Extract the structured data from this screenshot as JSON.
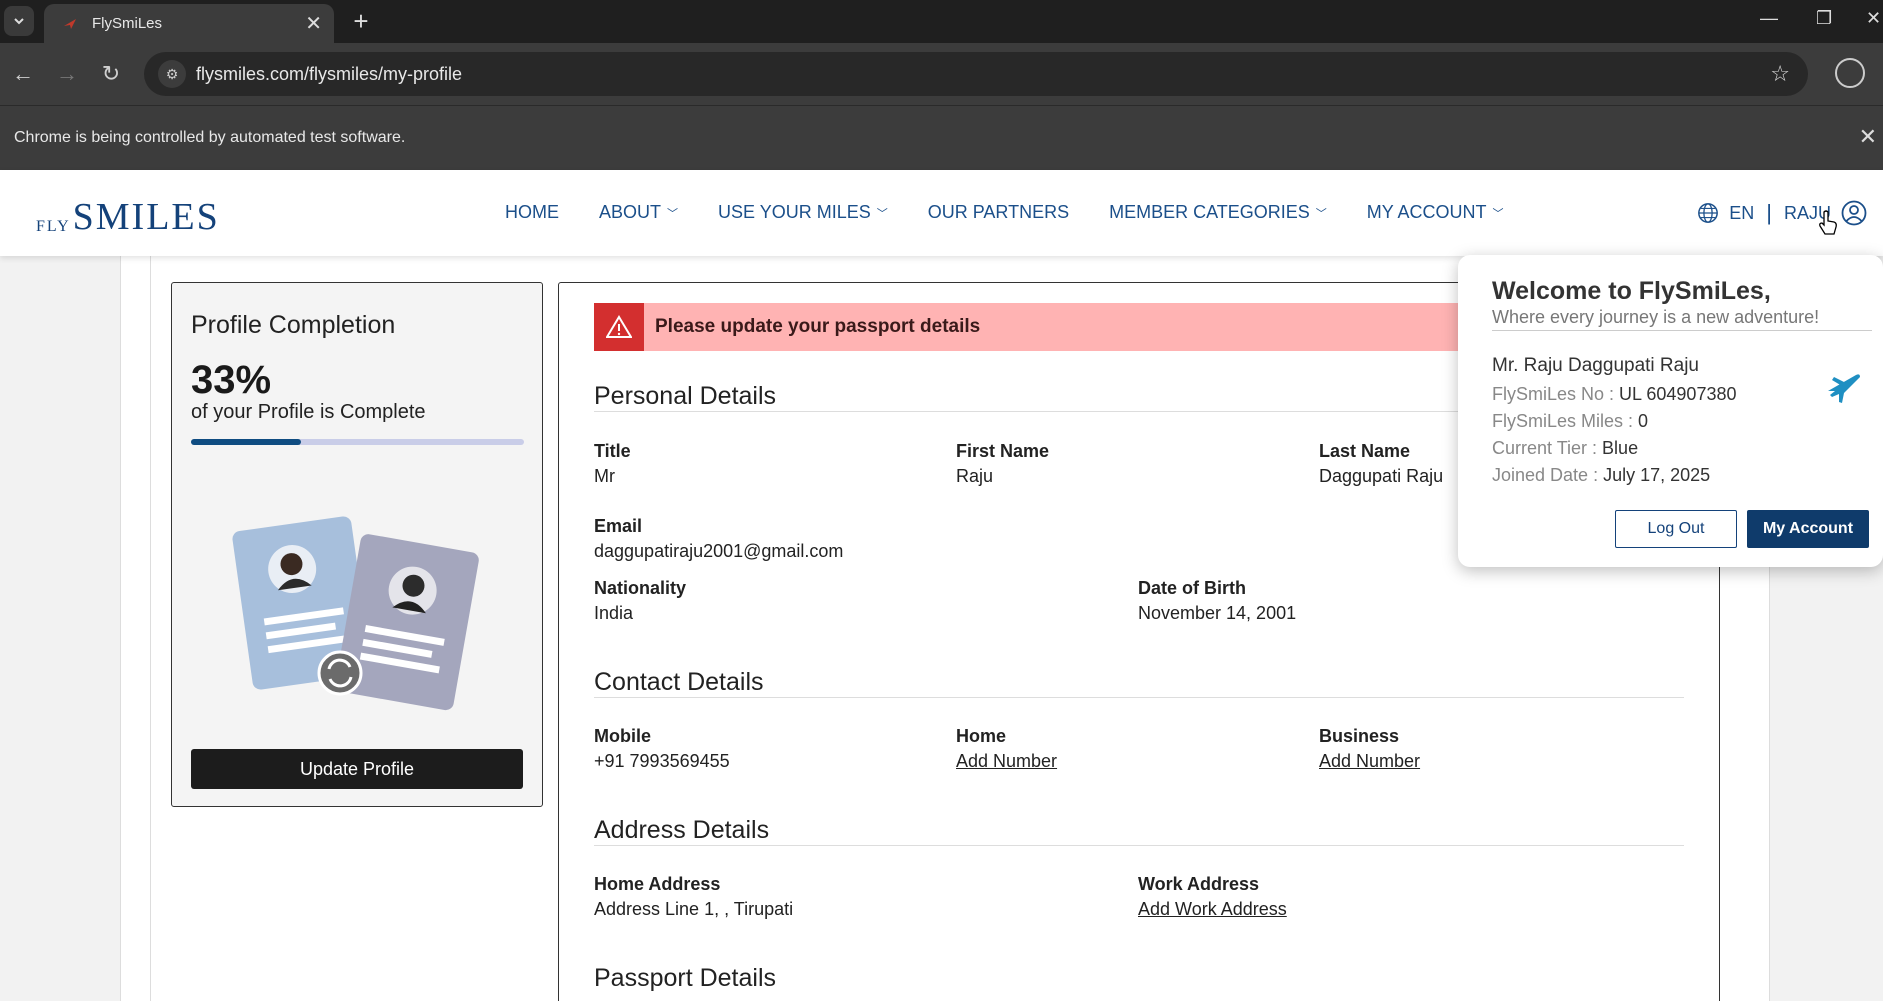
{
  "browser": {
    "tab_title": "FlySmiLes",
    "url": "flysmiles.com/flysmiles/my-profile",
    "infobar_text": "Chrome is being controlled by automated test software."
  },
  "header": {
    "logo_fly": "FLY",
    "logo_smiles": "SMILES",
    "nav": [
      {
        "label": "HOME"
      },
      {
        "label": "ABOUT"
      },
      {
        "label": "USE YOUR MILES"
      },
      {
        "label": "OUR PARTNERS"
      },
      {
        "label": "MEMBER CATEGORIES"
      },
      {
        "label": "MY ACCOUNT"
      }
    ],
    "language": "EN",
    "username": "RAJU",
    "separator": "|"
  },
  "profile_completion": {
    "title": "Profile Completion",
    "percent_text": "33%",
    "subtitle": "of your Profile is Complete",
    "progress": 0.33,
    "button": "Update Profile"
  },
  "alert": {
    "text": "Please update your passport details"
  },
  "personal": {
    "title": "Personal Details",
    "title_label": "Title",
    "title_value": "Mr",
    "first_label": "First Name",
    "first_value": "Raju",
    "last_label": "Last Name",
    "last_value": "Daggupati Raju",
    "email_label": "Email",
    "email_value": "daggupatiraju2001@gmail.com",
    "nationality_label": "Nationality",
    "nationality_value": "India",
    "dob_label": "Date of Birth",
    "dob_value": "November 14, 2001"
  },
  "contact": {
    "title": "Contact Details",
    "mobile_label": "Mobile",
    "mobile_value": "+91 7993569455",
    "home_label": "Home",
    "home_link": "Add Number",
    "business_label": "Business",
    "business_link": "Add Number"
  },
  "address": {
    "title": "Address Details",
    "home_label": "Home Address",
    "home_value": "Address Line 1, , Tirupati",
    "work_label": "Work Address",
    "work_link": "Add Work Address"
  },
  "passport": {
    "title": "Passport Details"
  },
  "popup": {
    "welcome": "Welcome to FlySmiLes,",
    "tagline": "Where every journey is a new adventure!",
    "name": "Mr. Raju Daggupati Raju",
    "no_key": "FlySmiLes No :",
    "no_val": "UL 604907380",
    "miles_key": "FlySmiLes Miles :",
    "miles_val": "0",
    "tier_key": "Current Tier :",
    "tier_val": "Blue",
    "joined_key": "Joined Date :",
    "joined_val": "July 17, 2025",
    "logout": "Log Out",
    "my_account": "My Account"
  },
  "colors": {
    "brand": "#14427a",
    "nav": "#1b4f8a",
    "alert_bg": "#ffb3b3",
    "alert_icon": "#d32f2f",
    "progress_fill": "#0f4c81"
  }
}
